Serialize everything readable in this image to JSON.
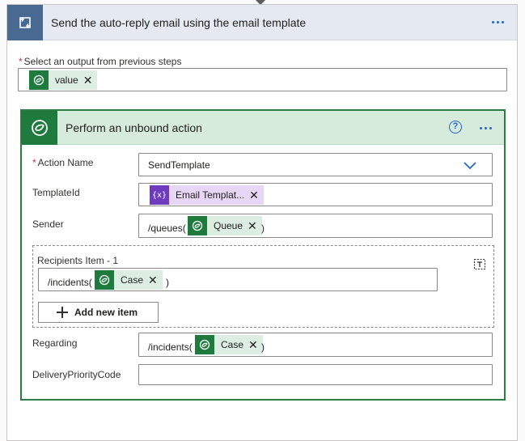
{
  "outer": {
    "title": "Send the auto-reply email using the email template",
    "output_label": "Select an output from previous steps",
    "output_token": "value"
  },
  "action": {
    "title": "Perform an unbound action",
    "help_glyph": "?",
    "action_name_label": "Action Name",
    "action_name_value": "SendTemplate",
    "template_label": "TemplateId",
    "template_token": "Email Templat...",
    "template_token_glyph": "{x}",
    "sender_label": "Sender",
    "sender_prefix": "/queues(",
    "sender_token": "Queue",
    "sender_suffix": ")",
    "recipients_label": "Recipients Item - 1",
    "recipients_prefix": "/incidents(",
    "recipients_token": "Case",
    "recipients_suffix": ")",
    "add_item_label": "Add new item",
    "regarding_label": "Regarding",
    "regarding_prefix": "/incidents(",
    "regarding_token": "Case",
    "regarding_suffix": ")",
    "delivery_label": "DeliveryPriorityCode",
    "delivery_value": ""
  },
  "colors": {
    "loop_tile": "#486991",
    "dataverse_green": "#1e7b3d",
    "variable_purple": "#6e3bbf",
    "link_blue": "#2266c8",
    "required_red": "#c4314b"
  },
  "icons": {
    "loop": "loop-icon",
    "dataverse": "dataverse-icon",
    "variable": "variable-icon",
    "help": "help-icon",
    "more": "more-icon",
    "chevron": "chevron-down-icon",
    "delete": "delete-icon",
    "plus": "plus-icon",
    "remove": "remove-token-icon"
  }
}
